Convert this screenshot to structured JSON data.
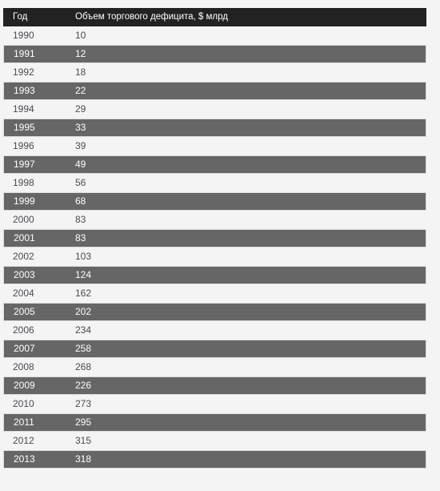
{
  "table": {
    "columns": [
      {
        "key": "year",
        "label": "Год"
      },
      {
        "key": "value",
        "label": "Объем торгового дефицита, $ млрд"
      }
    ],
    "colors": {
      "header_bg": "#222222",
      "header_text": "#ffffff",
      "row_light_bg": "#f4f4f4",
      "row_light_text": "#4a4a52",
      "row_dark_bg": "#666666",
      "row_dark_text": "#ffffff",
      "page_bg": "#f4f4f4",
      "row_border": "#dcdcdc"
    },
    "rows": [
      {
        "year": "1990",
        "value": "10"
      },
      {
        "year": "1991",
        "value": "12"
      },
      {
        "year": "1992",
        "value": "18"
      },
      {
        "year": "1993",
        "value": "22"
      },
      {
        "year": "1994",
        "value": "29"
      },
      {
        "year": "1995",
        "value": "33"
      },
      {
        "year": "1996",
        "value": "39"
      },
      {
        "year": "1997",
        "value": "49"
      },
      {
        "year": "1998",
        "value": "56"
      },
      {
        "year": "1999",
        "value": "68"
      },
      {
        "year": "2000",
        "value": "83"
      },
      {
        "year": "2001",
        "value": "83"
      },
      {
        "year": "2002",
        "value": "103"
      },
      {
        "year": "2003",
        "value": "124"
      },
      {
        "year": "2004",
        "value": "162"
      },
      {
        "year": "2005",
        "value": "202"
      },
      {
        "year": "2006",
        "value": "234"
      },
      {
        "year": "2007",
        "value": "258"
      },
      {
        "year": "2008",
        "value": "268"
      },
      {
        "year": "2009",
        "value": "226"
      },
      {
        "year": "2010",
        "value": "273"
      },
      {
        "year": "2011",
        "value": "295"
      },
      {
        "year": "2012",
        "value": "315"
      },
      {
        "year": "2013",
        "value": "318"
      }
    ]
  },
  "chart_data": {
    "type": "table",
    "title": "Объем торгового дефицита, $ млрд",
    "xlabel": "Год",
    "ylabel": "Объем торгового дефицита, $ млрд",
    "categories": [
      "1990",
      "1991",
      "1992",
      "1993",
      "1994",
      "1995",
      "1996",
      "1997",
      "1998",
      "1999",
      "2000",
      "2001",
      "2002",
      "2003",
      "2004",
      "2005",
      "2006",
      "2007",
      "2008",
      "2009",
      "2010",
      "2011",
      "2012",
      "2013"
    ],
    "values": [
      10,
      12,
      18,
      22,
      29,
      33,
      39,
      49,
      56,
      68,
      83,
      83,
      103,
      124,
      162,
      202,
      234,
      258,
      268,
      226,
      273,
      295,
      315,
      318
    ]
  }
}
